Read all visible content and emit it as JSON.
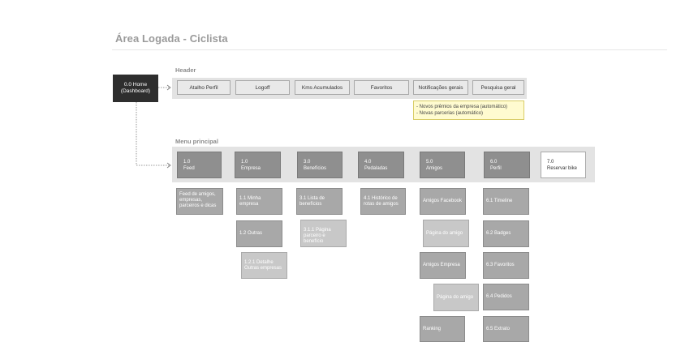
{
  "title": "Área Logada - Ciclista",
  "header_section": {
    "label": "Header",
    "buttons": [
      "Atalho Perfil",
      "Logoff",
      "Kms Acumulados",
      "Favoritos",
      "Notificações gerais",
      "Pesquisa geral"
    ]
  },
  "home_box": {
    "line1": "0.0 Home",
    "line2": "(Dashboard)"
  },
  "notes": {
    "line1": "- Novos prêmios da empresa (automático)",
    "line2": "- Novas parcerias (automático)"
  },
  "menu_section": {
    "label": "Menu principal",
    "items": [
      {
        "num": "1.0",
        "label": "Feed"
      },
      {
        "num": "1.0",
        "label": "Empresa"
      },
      {
        "num": "3.0",
        "label": "Benefícios"
      },
      {
        "num": "4.0",
        "label": "Pedaladas"
      },
      {
        "num": "5.0",
        "label": "Amigos"
      },
      {
        "num": "6.0",
        "label": "Perfil"
      },
      {
        "num": "7.0",
        "label": "Reservar bike"
      }
    ]
  },
  "subs": {
    "feed": "Feed de amigos, empresas, parceiros e dicas",
    "empresa_1": "1.1 Minha empresa",
    "empresa_2": "1.2 Outras",
    "empresa_3": "1.2.1 Detalhe Outras empresas",
    "beneficios_1": "3.1 Lista de benefícios",
    "beneficios_2": "3.1.1 Página parceiro e benefício",
    "pedaladas_1": "4.1 Histórico de rotas de amigos",
    "amigos_1": "Amigos Facebook",
    "amigos_2": "Página do amigo",
    "amigos_3": "Amigos Empresa",
    "amigos_4": "Página do amigo",
    "amigos_5": "Ranking",
    "perfil_1": "6.1 Timeline",
    "perfil_2": "6.2 Badges",
    "perfil_3": "6.3 Favoritos",
    "perfil_4": "6.4 Pedidos",
    "perfil_5": "6.5 Extrato"
  }
}
